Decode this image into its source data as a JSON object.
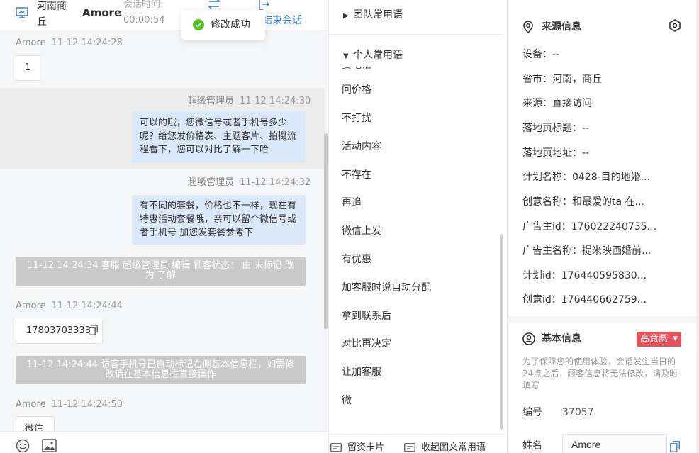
{
  "header": {
    "location": "河南商丘",
    "username": "Amore",
    "session_time_label": "会话时间:",
    "session_time_value": "00:00:54",
    "end_label": "结束会话",
    "toast": "修改成功"
  },
  "messages": {
    "m1": {
      "sender": "Amore",
      "time": "11-12 14:24:28",
      "text": "1"
    },
    "m2": {
      "sender": "超级管理员",
      "time": "11-12 14:24:30",
      "text": "可以的哦，您微信号或者手机号多少呢？给您发价格表、主题客片、拍摄流程看下，您可以对比了解一下哈"
    },
    "m3": {
      "sender": "超级管理员",
      "time": "11-12 14:24:32",
      "text": "有不同的套餐，价格也不一样，现在有特惠活动套餐哦，亲可以留个微信号或者手机号 加您发套餐参考下"
    },
    "sys1": "11-12 14:24:34 客服 超级管理员 编辑 顾客状态： 由 未标记 改为 了解",
    "m4": {
      "sender": "Amore",
      "time": "11-12 14:24:44",
      "text": "17803703333"
    },
    "sys2": "11-12 14:24:44 访客手机号已自动标记右侧基本信息栏，如需修改请在基本信息栏直接操作",
    "m5": {
      "sender": "Amore",
      "time": "11-12 14:24:50",
      "text": "微信"
    }
  },
  "phrases": {
    "team_group": "团队常用语",
    "personal_group": "个人常用语",
    "cut_item": "要电话",
    "items": [
      "问价格",
      "不打扰",
      "活动内容",
      "不存在",
      "再追",
      "微信上发",
      "有优惠",
      "加客服时说自动分配",
      "拿到联系后",
      "对比再决定",
      "让加客服",
      "微"
    ],
    "footer_card": "留资卡片",
    "footer_collapse": "收起图文常用语"
  },
  "info": {
    "source_title": "来源信息",
    "source_fields": [
      "设备：--",
      "省市：河南，商丘",
      "来源：直接访问",
      "落地页标题：--",
      "落地页地址：--",
      "计划名称：0428-目的地婚...",
      "创意名称：和最爱的ta 在...",
      "广告主id：176022240735...",
      "广告主名称：提米映画婚前...",
      "计划id：176440595830...",
      "创意id：176440662759..."
    ],
    "basic_title": "基本信息",
    "intent_badge": "高意愿",
    "notice": "为了保障您的使用体验，会话发生当日的24点之后，顾客信息将无法修改，请及时填写",
    "id_label": "编号",
    "id_value": "37057",
    "name_label": "姓名",
    "name_value": "Amore"
  },
  "colors": {
    "accent": "#3a7bd5",
    "bubble_agent": "#dbe7fb",
    "badge_red": "#e8505b",
    "toast_green": "#52c41a",
    "system_note": "#c9c9c9"
  }
}
